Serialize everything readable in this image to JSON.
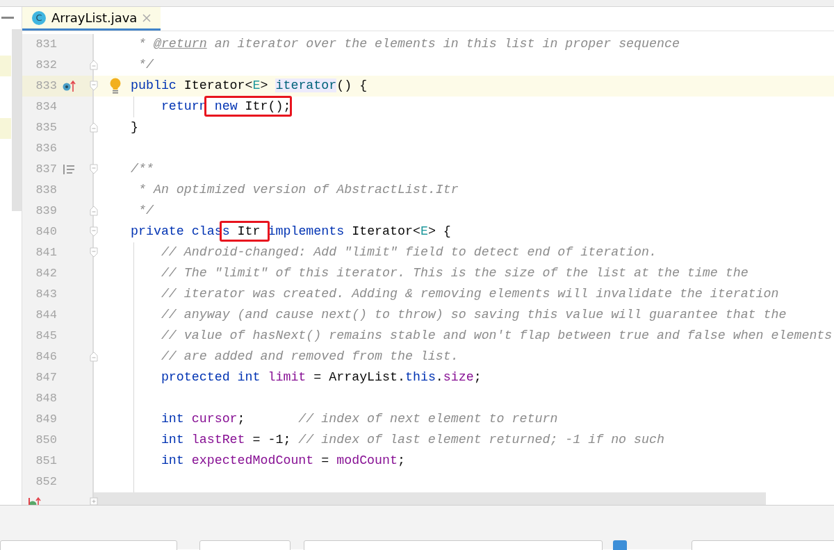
{
  "tab": {
    "icon_letter": "C",
    "label": "ArrayList.java",
    "selected": true
  },
  "lines": [
    {
      "number": "831",
      "tokens": [
        {
          "text": " * ",
          "kind": "comment"
        },
        {
          "text": "@return",
          "kind": "doctag"
        },
        {
          "text": " an iterator over the elements in this list in proper sequence",
          "kind": "comment"
        }
      ]
    },
    {
      "number": "832",
      "fold_end": true,
      "tokens": [
        {
          "text": " */",
          "kind": "comment"
        }
      ]
    },
    {
      "number": "833",
      "caret": true,
      "overrides": true,
      "intention": true,
      "fold_start": true,
      "tokens": [
        {
          "text": "public ",
          "kind": "keyword"
        },
        {
          "text": "Iterator<",
          "kind": "plain"
        },
        {
          "text": "E",
          "kind": "typeparam"
        },
        {
          "text": "> ",
          "kind": "plain"
        },
        {
          "text": "iterator",
          "kind": "declaration"
        },
        {
          "text": "() {",
          "kind": "plain"
        }
      ]
    },
    {
      "number": "834",
      "guide": true,
      "tokens": [
        {
          "text": "    return",
          "kind": "keyword"
        },
        {
          "text": " new",
          "kind": "keyword",
          "boxed": true
        },
        {
          "text": " Itr();",
          "kind": "plain",
          "boxed": true
        }
      ]
    },
    {
      "number": "835",
      "fold_end": true,
      "tokens": [
        {
          "text": "}",
          "kind": "plain"
        }
      ]
    },
    {
      "number": "836"
    },
    {
      "number": "837",
      "has_doc": true,
      "fold_start": true,
      "tokens": [
        {
          "text": "/**",
          "kind": "comment"
        }
      ]
    },
    {
      "number": "838",
      "tokens": [
        {
          "text": " * An optimized version of AbstractList.Itr",
          "kind": "comment"
        }
      ]
    },
    {
      "number": "839",
      "fold_end": true,
      "tokens": [
        {
          "text": " */",
          "kind": "comment"
        }
      ]
    },
    {
      "number": "840",
      "fold_start": true,
      "tokens": [
        {
          "text": "private clas",
          "kind": "keyword"
        },
        {
          "text": "s",
          "kind": "keyword",
          "boxed": true
        },
        {
          "text": " Itr ",
          "kind": "plain",
          "boxed": true
        },
        {
          "text": "implements",
          "kind": "keyword"
        },
        {
          "text": " Iterator<",
          "kind": "plain"
        },
        {
          "text": "E",
          "kind": "typeparam"
        },
        {
          "text": "> {",
          "kind": "plain"
        }
      ]
    },
    {
      "number": "841",
      "guide": true,
      "fold_start": true,
      "tokens": [
        {
          "text": "    // Android-changed: Add \"limit\" field to detect end of iteration.",
          "kind": "comment"
        }
      ]
    },
    {
      "number": "842",
      "guide": true,
      "tokens": [
        {
          "text": "    // The \"limit\" of this iterator. This is the size of the list at the time the",
          "kind": "comment"
        }
      ]
    },
    {
      "number": "843",
      "guide": true,
      "tokens": [
        {
          "text": "    // iterator was created. Adding & removing elements will invalidate the iteration",
          "kind": "comment"
        }
      ]
    },
    {
      "number": "844",
      "guide": true,
      "tokens": [
        {
          "text": "    // anyway (and cause next() to throw) so saving this value will guarantee that the",
          "kind": "comment"
        }
      ]
    },
    {
      "number": "845",
      "guide": true,
      "tokens": [
        {
          "text": "    // value of hasNext() remains stable and won't flap between true and false when elements",
          "kind": "comment"
        }
      ]
    },
    {
      "number": "846",
      "guide": true,
      "fold_end": true,
      "tokens": [
        {
          "text": "    // are added and removed from the list.",
          "kind": "comment"
        }
      ]
    },
    {
      "number": "847",
      "guide": true,
      "tokens": [
        {
          "text": "    protected int ",
          "kind": "keyword"
        },
        {
          "text": "limit",
          "kind": "field"
        },
        {
          "text": " = ArrayList.",
          "kind": "plain"
        },
        {
          "text": "this",
          "kind": "keyword"
        },
        {
          "text": ".",
          "kind": "plain"
        },
        {
          "text": "size",
          "kind": "field"
        },
        {
          "text": ";",
          "kind": "plain"
        }
      ]
    },
    {
      "number": "848",
      "guide": true
    },
    {
      "number": "849",
      "guide": true,
      "tokens": [
        {
          "text": "    int ",
          "kind": "keyword"
        },
        {
          "text": "cursor",
          "kind": "field"
        },
        {
          "text": ";       ",
          "kind": "plain"
        },
        {
          "text": "// index of next element to return",
          "kind": "comment"
        }
      ]
    },
    {
      "number": "850",
      "guide": true,
      "tokens": [
        {
          "text": "    int ",
          "kind": "keyword"
        },
        {
          "text": "lastRet",
          "kind": "field"
        },
        {
          "text": " = -1; ",
          "kind": "plain"
        },
        {
          "text": "// index of last element returned; -1 if no such",
          "kind": "comment"
        }
      ]
    },
    {
      "number": "851",
      "guide": true,
      "tokens": [
        {
          "text": "    int ",
          "kind": "keyword"
        },
        {
          "text": "expectedModCount",
          "kind": "field"
        },
        {
          "text": " = ",
          "kind": "plain"
        },
        {
          "text": "modCount",
          "kind": "field"
        },
        {
          "text": ";",
          "kind": "plain"
        }
      ]
    },
    {
      "number": "852",
      "guide": true
    },
    {
      "implements": true,
      "shaded": true,
      "folded": true
    }
  ],
  "bottom_panel": {
    "checkbox": {
      "checked": true
    }
  }
}
